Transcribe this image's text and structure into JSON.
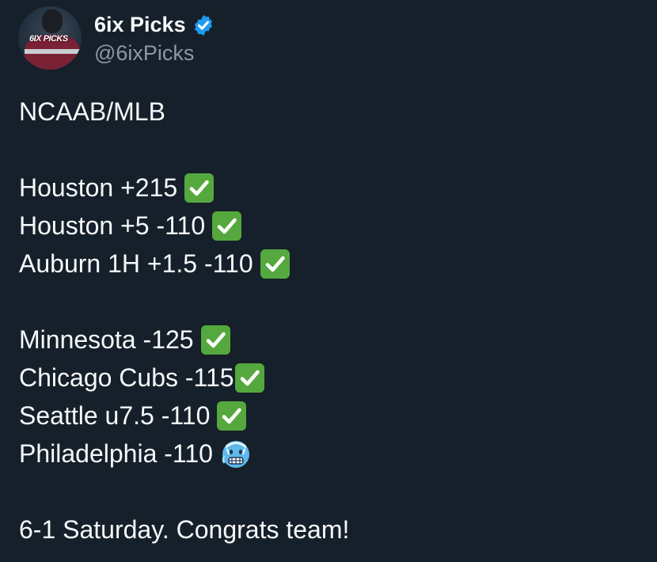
{
  "profile": {
    "display_name": "6ix Picks",
    "handle": "@6ixPicks",
    "avatar_text": "6IX PICKS",
    "verified_icon": "verified-badge-icon",
    "accent_color": "#1d9bf0"
  },
  "tweet": {
    "header": "NCAAB/MLB",
    "group1": [
      {
        "text": "Houston +215",
        "status": "check-icon"
      },
      {
        "text": "Houston +5 -110",
        "status": "check-icon"
      },
      {
        "text": "Auburn 1H +1.5 -110",
        "status": "check-icon"
      }
    ],
    "group2": [
      {
        "text": "Minnesota -125",
        "status": "check-icon"
      },
      {
        "text": "Chicago Cubs -115",
        "status": "check-icon"
      },
      {
        "text": "Seattle u7.5 -110",
        "status": "check-icon"
      },
      {
        "text": "Philadelphia -110",
        "status": "cold-face-icon"
      }
    ],
    "footer": "6-1 Saturday. Congrats team!"
  },
  "colors": {
    "background": "#15202b",
    "text": "#f7f9f9",
    "muted": "#8b98a5",
    "check_green": "#55a83d"
  }
}
